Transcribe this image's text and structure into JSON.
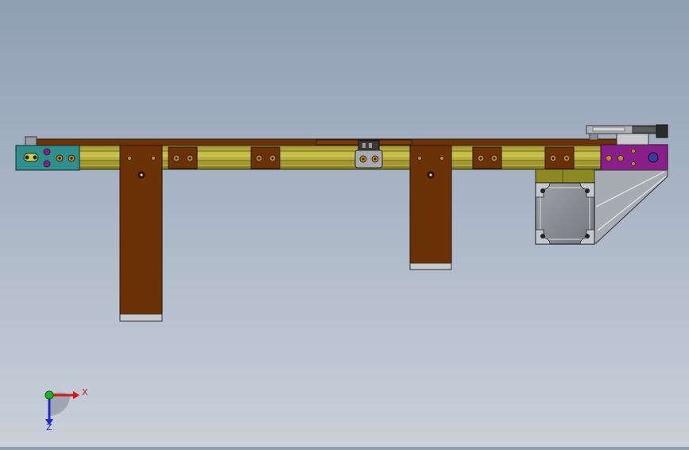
{
  "viewport": {
    "background_top": "#8f9fb4",
    "background_bottom": "#c9d0da"
  },
  "colors": {
    "rail": "#b5ad3a",
    "rail_dark": "#6f6a1c",
    "brown": "#6b3208",
    "brown_dark": "#3c1a04",
    "teal": "#2f8f8c",
    "purple": "#8a1f8a",
    "gray_part": "#8a8e94",
    "foot": "#c7c9cc",
    "x_axis": "#d01818",
    "y_axis": "#22b022",
    "z_axis": "#1a2ad0"
  },
  "triad": {
    "x_label": "X",
    "z_label": "Z"
  }
}
